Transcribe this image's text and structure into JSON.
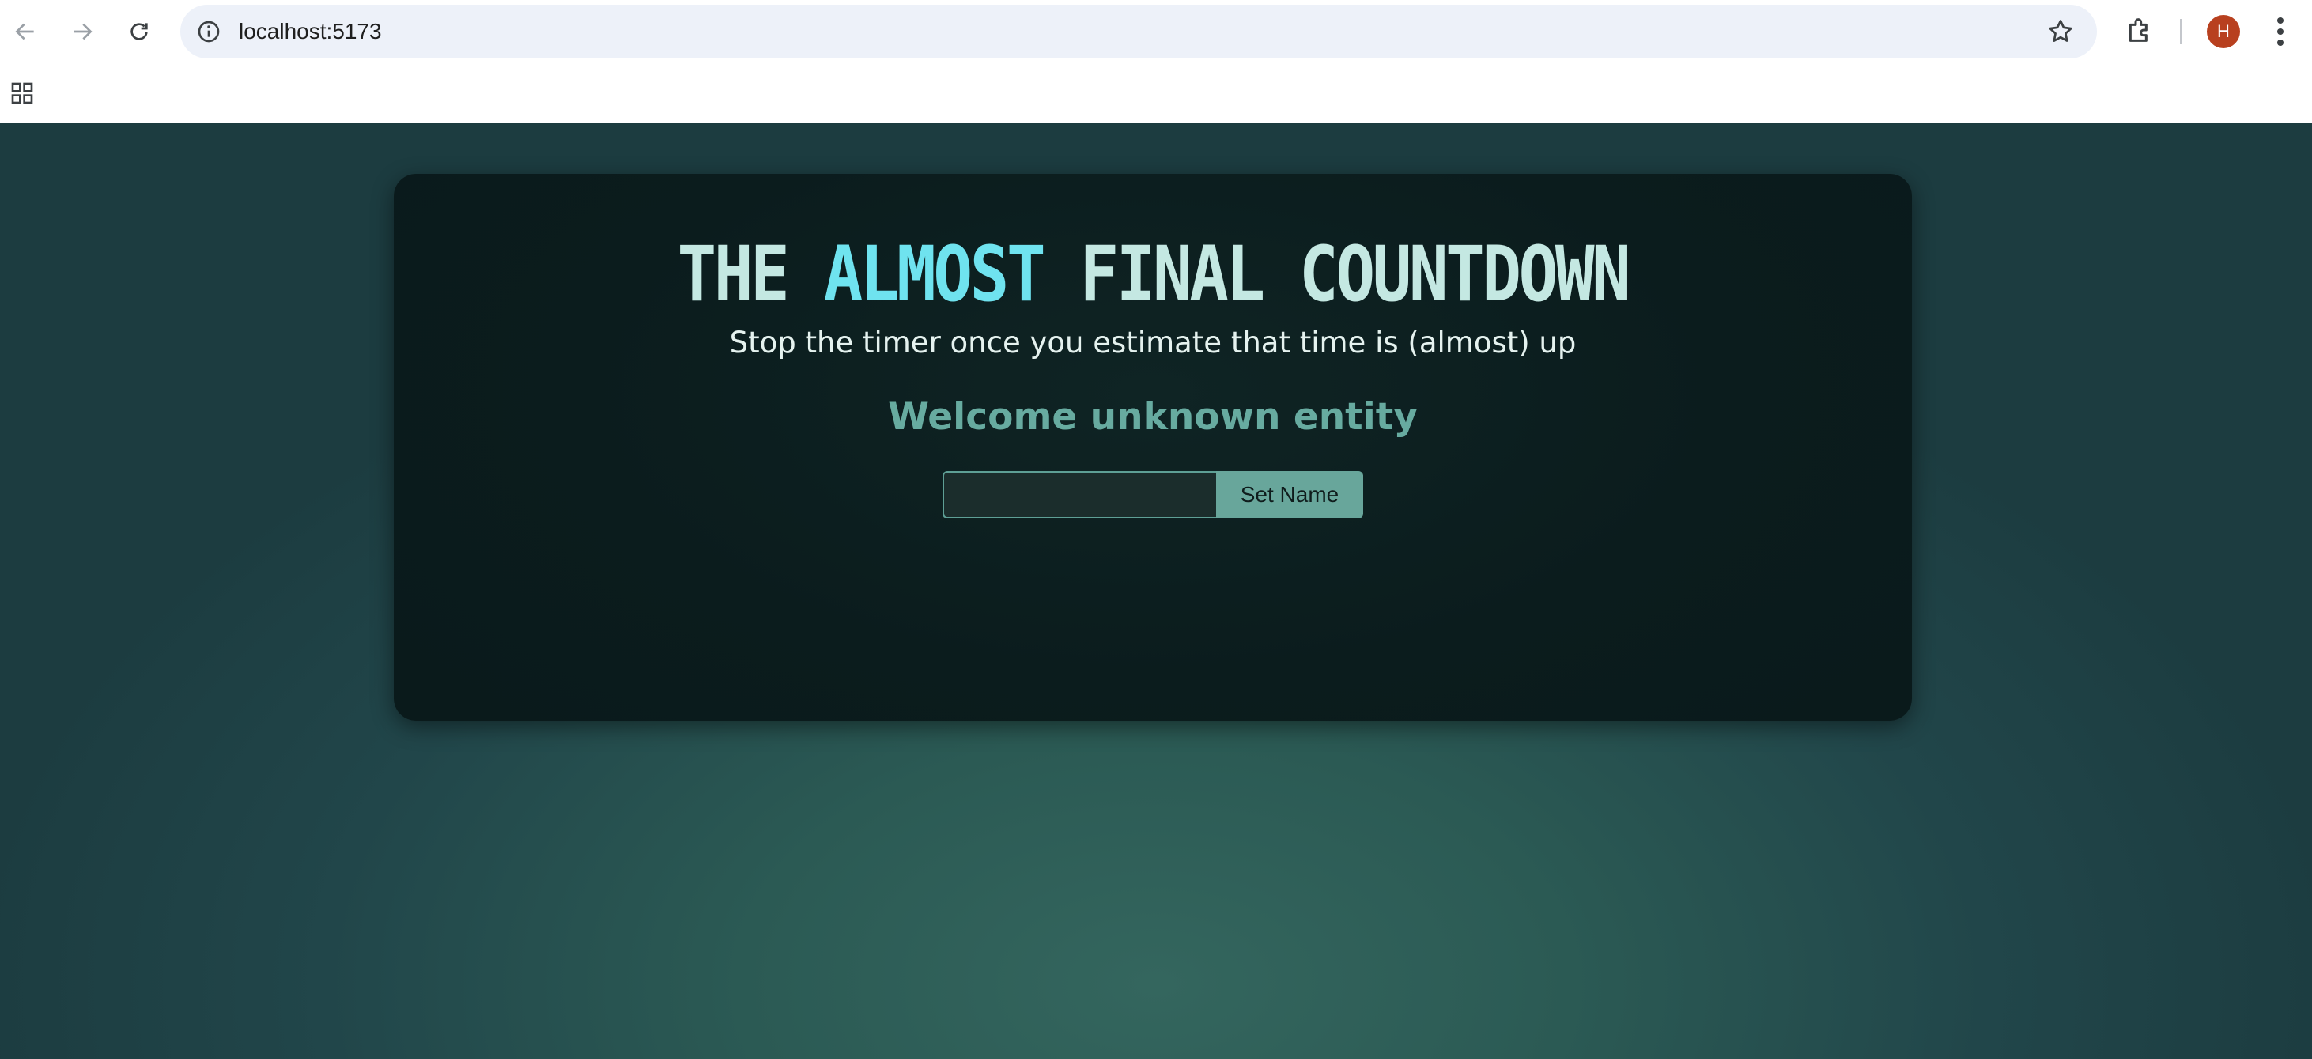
{
  "browser": {
    "url": "localhost:5173",
    "profile_initial": "H",
    "icons": [
      "back-icon",
      "forward-icon",
      "reload-icon",
      "info-icon",
      "star-icon",
      "extensions-icon",
      "menu-icon",
      "apps-icon"
    ]
  },
  "page": {
    "title_part1": "THE ",
    "title_accent": "ALMOST",
    "title_part2": " FINAL COUNTDOWN",
    "subtitle": "Stop the timer once you estimate that time is (almost) up",
    "welcome": "Welcome unknown entity",
    "name_input_value": "",
    "set_name_label": "Set Name"
  },
  "colors": {
    "accent": "#6fe3ef",
    "title": "#c4e8e2",
    "welcome": "#67aba0",
    "button": "#68a69b",
    "card_bg": "#0b1c1d",
    "page_bg": "#2b5a54"
  }
}
